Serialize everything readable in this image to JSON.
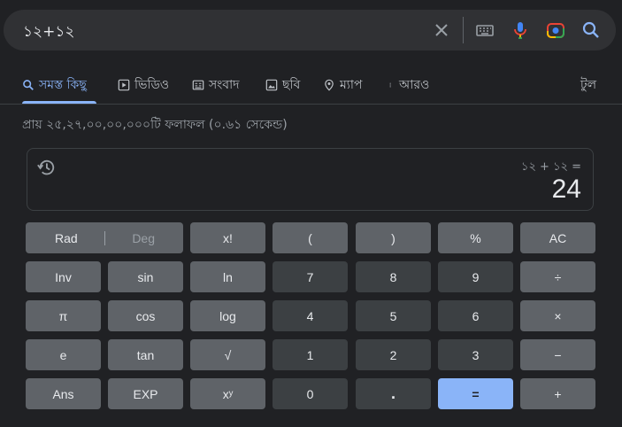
{
  "search": {
    "query": "১২+১২"
  },
  "tabs": [
    {
      "label": "সমস্ত কিছু",
      "icon": "search-icon"
    },
    {
      "label": "ভিডিও",
      "icon": "video-icon"
    },
    {
      "label": "সংবাদ",
      "icon": "news-icon"
    },
    {
      "label": "ছবি",
      "icon": "image-icon"
    },
    {
      "label": "ম্যাপ",
      "icon": "map-pin-icon"
    },
    {
      "label": "আরও",
      "icon": "more-vert-icon"
    }
  ],
  "tools_label": "টুল",
  "result_stats": "প্রায় ২৫,২৭,০০,০০,০০০টি ফলাফল (০.৬১ সেকেন্ড)",
  "calculator": {
    "expression": "১২ + ১২ =",
    "result": "24",
    "mode_rad": "Rad",
    "mode_deg": "Deg",
    "keys": {
      "fact": "x!",
      "lparen": "(",
      "rparen": ")",
      "percent": "%",
      "ac": "AC",
      "inv": "Inv",
      "sin": "sin",
      "ln": "ln",
      "d7": "7",
      "d8": "8",
      "d9": "9",
      "divide": "÷",
      "pi": "π",
      "cos": "cos",
      "log": "log",
      "d4": "4",
      "d5": "5",
      "d6": "6",
      "multiply": "×",
      "e": "e",
      "tan": "tan",
      "sqrt": "√",
      "d1": "1",
      "d2": "2",
      "d3": "3",
      "minus": "−",
      "ans": "Ans",
      "exp": "EXP",
      "pow": "xʸ",
      "d0": "0",
      "dot": ".",
      "equals": "=",
      "plus": "+"
    }
  }
}
